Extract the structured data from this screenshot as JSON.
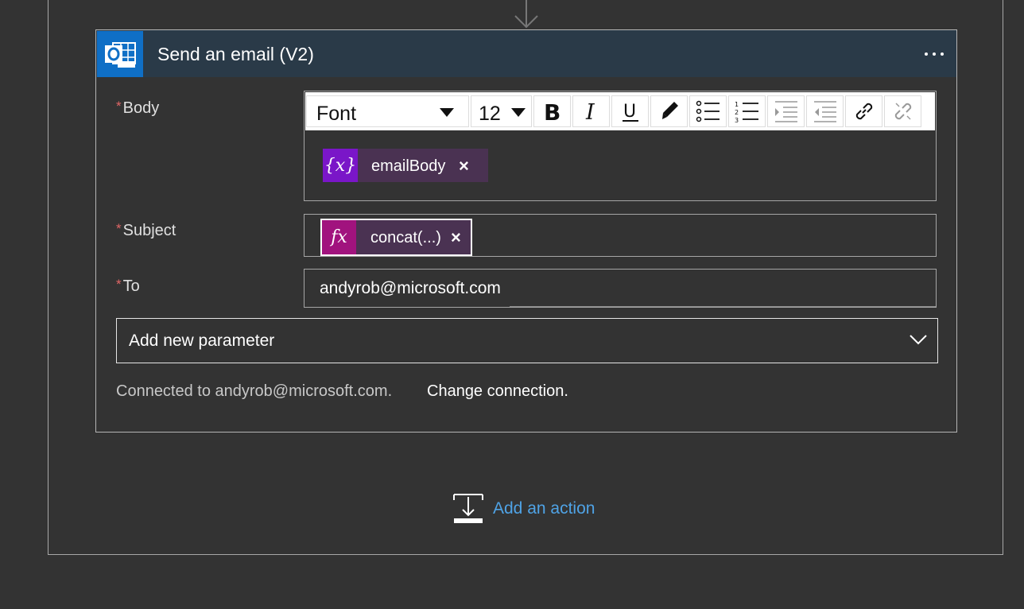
{
  "card": {
    "title": "Send an email (V2)",
    "app_icon": "outlook-icon",
    "more_icon": "ellipsis-icon",
    "header_color": "#2a3a48",
    "app_color": "#0f6fc6"
  },
  "fields": {
    "required_marker": "*",
    "body_label": "Body",
    "subject_label": "Subject",
    "to_label": "To"
  },
  "toolbar": {
    "font_label": "Font",
    "size_label": "12",
    "bold_label": "B",
    "italic_label": "I",
    "underline_label": "U",
    "icons": [
      "bold-icon",
      "italic-icon",
      "underline-icon",
      "highlight-pen-icon",
      "bulleted-list-icon",
      "numbered-list-icon",
      "indent-icon",
      "outdent-icon",
      "link-icon",
      "unlink-icon"
    ]
  },
  "body_token": {
    "icon_text": "{x}",
    "label": "emailBody",
    "close": "×",
    "icon_color": "#7a16c8"
  },
  "subject_token": {
    "icon_text": "fx",
    "label": "concat(...)",
    "close": "×",
    "icon_color": "#a1137e"
  },
  "to_value": "andyrob@microsoft.com",
  "add_parameter": {
    "label": "Add new parameter",
    "chevron_icon": "chevron-down-icon"
  },
  "connection": {
    "status": "Connected to andyrob@microsoft.com.",
    "change_label": "Change connection."
  },
  "add_action": {
    "label": "Add an action",
    "icon": "insert-step-icon",
    "color": "#4fa3e6"
  }
}
